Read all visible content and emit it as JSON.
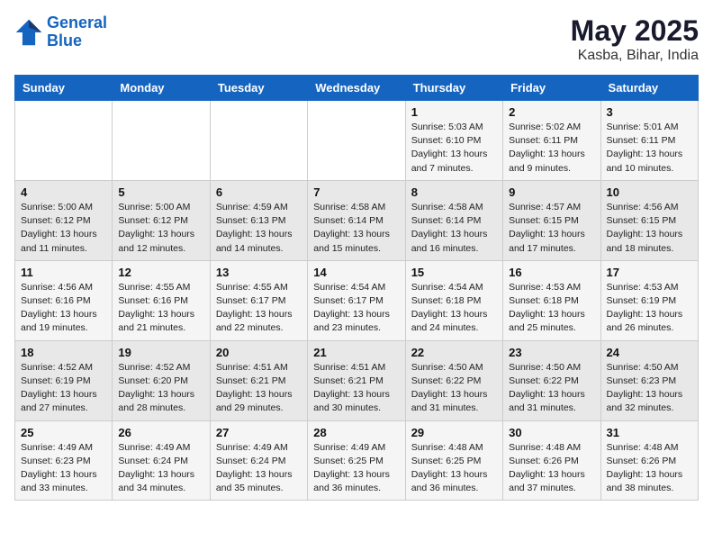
{
  "header": {
    "logo_line1": "General",
    "logo_line2": "Blue",
    "title": "May 2025",
    "subtitle": "Kasba, Bihar, India"
  },
  "calendar": {
    "days_of_week": [
      "Sunday",
      "Monday",
      "Tuesday",
      "Wednesday",
      "Thursday",
      "Friday",
      "Saturday"
    ],
    "weeks": [
      [
        {
          "day": "",
          "info": ""
        },
        {
          "day": "",
          "info": ""
        },
        {
          "day": "",
          "info": ""
        },
        {
          "day": "",
          "info": ""
        },
        {
          "day": "1",
          "info": "Sunrise: 5:03 AM\nSunset: 6:10 PM\nDaylight: 13 hours\nand 7 minutes."
        },
        {
          "day": "2",
          "info": "Sunrise: 5:02 AM\nSunset: 6:11 PM\nDaylight: 13 hours\nand 9 minutes."
        },
        {
          "day": "3",
          "info": "Sunrise: 5:01 AM\nSunset: 6:11 PM\nDaylight: 13 hours\nand 10 minutes."
        }
      ],
      [
        {
          "day": "4",
          "info": "Sunrise: 5:00 AM\nSunset: 6:12 PM\nDaylight: 13 hours\nand 11 minutes."
        },
        {
          "day": "5",
          "info": "Sunrise: 5:00 AM\nSunset: 6:12 PM\nDaylight: 13 hours\nand 12 minutes."
        },
        {
          "day": "6",
          "info": "Sunrise: 4:59 AM\nSunset: 6:13 PM\nDaylight: 13 hours\nand 14 minutes."
        },
        {
          "day": "7",
          "info": "Sunrise: 4:58 AM\nSunset: 6:14 PM\nDaylight: 13 hours\nand 15 minutes."
        },
        {
          "day": "8",
          "info": "Sunrise: 4:58 AM\nSunset: 6:14 PM\nDaylight: 13 hours\nand 16 minutes."
        },
        {
          "day": "9",
          "info": "Sunrise: 4:57 AM\nSunset: 6:15 PM\nDaylight: 13 hours\nand 17 minutes."
        },
        {
          "day": "10",
          "info": "Sunrise: 4:56 AM\nSunset: 6:15 PM\nDaylight: 13 hours\nand 18 minutes."
        }
      ],
      [
        {
          "day": "11",
          "info": "Sunrise: 4:56 AM\nSunset: 6:16 PM\nDaylight: 13 hours\nand 19 minutes."
        },
        {
          "day": "12",
          "info": "Sunrise: 4:55 AM\nSunset: 6:16 PM\nDaylight: 13 hours\nand 21 minutes."
        },
        {
          "day": "13",
          "info": "Sunrise: 4:55 AM\nSunset: 6:17 PM\nDaylight: 13 hours\nand 22 minutes."
        },
        {
          "day": "14",
          "info": "Sunrise: 4:54 AM\nSunset: 6:17 PM\nDaylight: 13 hours\nand 23 minutes."
        },
        {
          "day": "15",
          "info": "Sunrise: 4:54 AM\nSunset: 6:18 PM\nDaylight: 13 hours\nand 24 minutes."
        },
        {
          "day": "16",
          "info": "Sunrise: 4:53 AM\nSunset: 6:18 PM\nDaylight: 13 hours\nand 25 minutes."
        },
        {
          "day": "17",
          "info": "Sunrise: 4:53 AM\nSunset: 6:19 PM\nDaylight: 13 hours\nand 26 minutes."
        }
      ],
      [
        {
          "day": "18",
          "info": "Sunrise: 4:52 AM\nSunset: 6:19 PM\nDaylight: 13 hours\nand 27 minutes."
        },
        {
          "day": "19",
          "info": "Sunrise: 4:52 AM\nSunset: 6:20 PM\nDaylight: 13 hours\nand 28 minutes."
        },
        {
          "day": "20",
          "info": "Sunrise: 4:51 AM\nSunset: 6:21 PM\nDaylight: 13 hours\nand 29 minutes."
        },
        {
          "day": "21",
          "info": "Sunrise: 4:51 AM\nSunset: 6:21 PM\nDaylight: 13 hours\nand 30 minutes."
        },
        {
          "day": "22",
          "info": "Sunrise: 4:50 AM\nSunset: 6:22 PM\nDaylight: 13 hours\nand 31 minutes."
        },
        {
          "day": "23",
          "info": "Sunrise: 4:50 AM\nSunset: 6:22 PM\nDaylight: 13 hours\nand 31 minutes."
        },
        {
          "day": "24",
          "info": "Sunrise: 4:50 AM\nSunset: 6:23 PM\nDaylight: 13 hours\nand 32 minutes."
        }
      ],
      [
        {
          "day": "25",
          "info": "Sunrise: 4:49 AM\nSunset: 6:23 PM\nDaylight: 13 hours\nand 33 minutes."
        },
        {
          "day": "26",
          "info": "Sunrise: 4:49 AM\nSunset: 6:24 PM\nDaylight: 13 hours\nand 34 minutes."
        },
        {
          "day": "27",
          "info": "Sunrise: 4:49 AM\nSunset: 6:24 PM\nDaylight: 13 hours\nand 35 minutes."
        },
        {
          "day": "28",
          "info": "Sunrise: 4:49 AM\nSunset: 6:25 PM\nDaylight: 13 hours\nand 36 minutes."
        },
        {
          "day": "29",
          "info": "Sunrise: 4:48 AM\nSunset: 6:25 PM\nDaylight: 13 hours\nand 36 minutes."
        },
        {
          "day": "30",
          "info": "Sunrise: 4:48 AM\nSunset: 6:26 PM\nDaylight: 13 hours\nand 37 minutes."
        },
        {
          "day": "31",
          "info": "Sunrise: 4:48 AM\nSunset: 6:26 PM\nDaylight: 13 hours\nand 38 minutes."
        }
      ]
    ]
  }
}
